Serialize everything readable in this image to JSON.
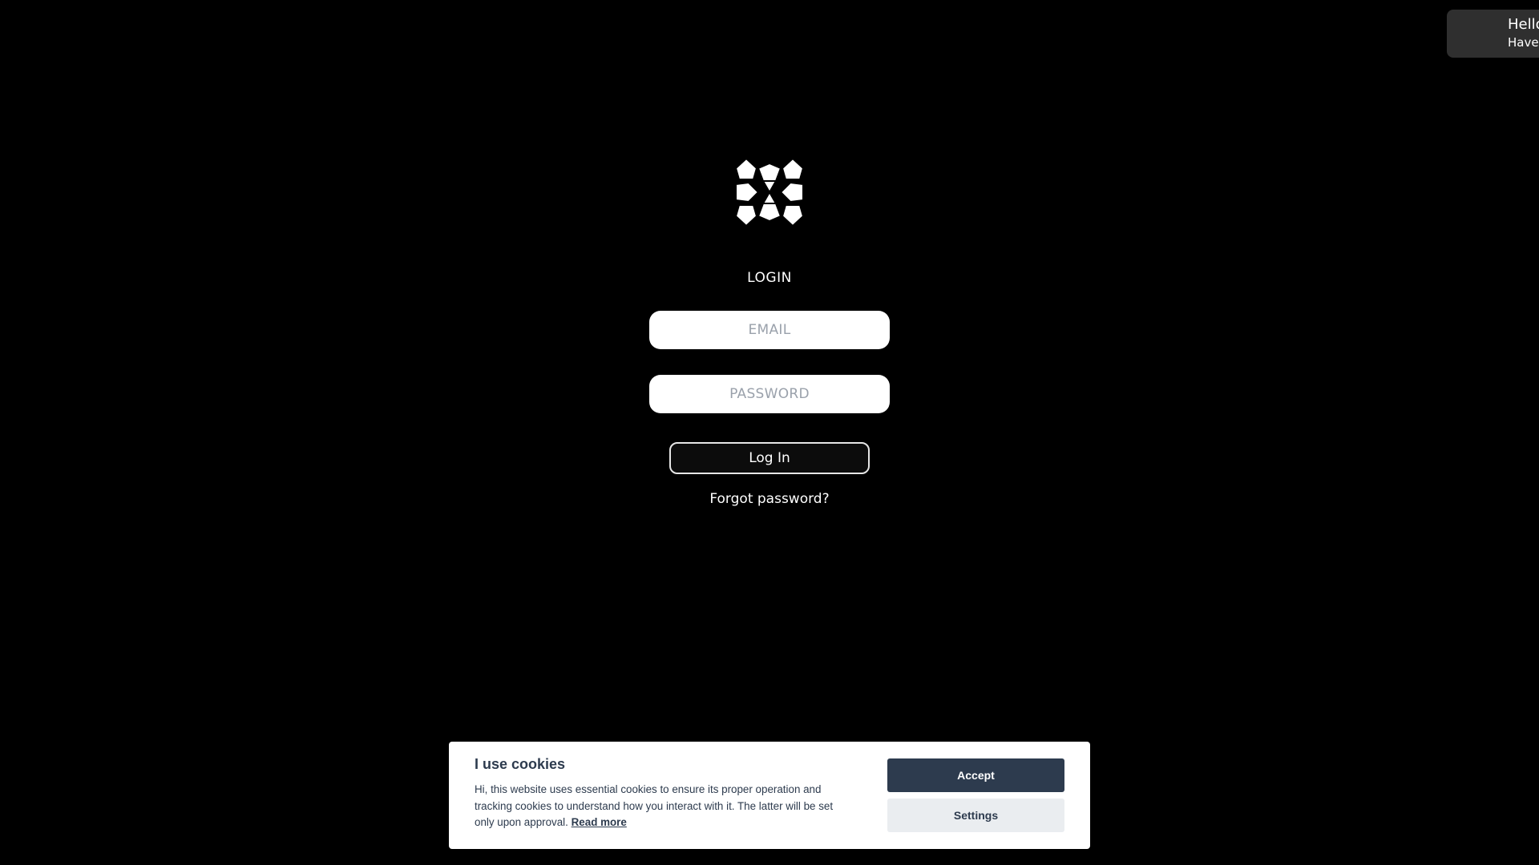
{
  "toast": {
    "title": "Hello",
    "body": "Have"
  },
  "login": {
    "heading": "LOGIN",
    "email_placeholder": "EMAIL",
    "password_placeholder": "PASSWORD",
    "submit_label": "Log In",
    "forgot_label": "Forgot password?"
  },
  "cookie": {
    "title": "I use cookies",
    "text": "Hi, this website uses essential cookies to ensure its proper operation and tracking cookies to understand how you interact with it. The latter will be set only upon approval.",
    "read_more": "Read more",
    "accept_label": "Accept",
    "settings_label": "Settings"
  },
  "colors": {
    "background": "#000000",
    "cookie_dark": "#2d3b4e",
    "cookie_light": "#eaedf0",
    "toast_bg": "#2f2f2f"
  },
  "icons": {
    "logo": "geometric-pentagon-logo"
  }
}
